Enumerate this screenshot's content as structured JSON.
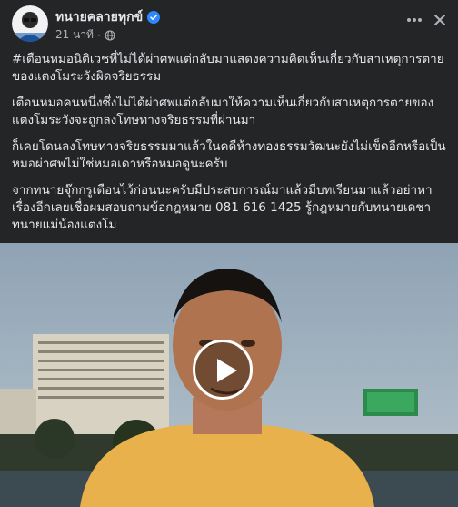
{
  "header": {
    "author": "ทนายคลายทุกข์",
    "timestamp": "21 นาที",
    "separator": "·",
    "verified": true,
    "privacy_icon": "globe-icon",
    "menu_icon": "more-icon",
    "close_icon": "close-icon"
  },
  "post": {
    "paragraphs": [
      "#เตือนหมอนิติเวชที่ไม่ได้ผ่าศพแต่กลับมาแสดงความคิดเห็นเกี่ยวกับสาเหตุการตายของแตงโมระวังผิดจริยธรรม",
      "เตือนหมอคนหนึ่งซึ่งไม่ได้ผ่าศพแต่กลับมาให้ความเห็นเกี่ยวกับสาเหตุการตายของแตงโมระวังจะถูกลงโทษทางจริยธรรมที่ผ่านมา",
      "ก็เคยโดนลงโทษทางจริยธรรมมาแล้วในคดีห้างทองธรรมวัฒนะยังไม่เข็ดอีกหรือเป็นหมอผ่าศพไม่ใช่หมอเดาหรือหมอดูนะครับ",
      "จากทนายจุ๊กกรูเตือนไว้ก่อนนะครับมีประสบการณ์มาแล้วมีบทเรียนมาแล้วอย่าหาเรื่องอีกเลยเชื่อผมสอบถามข้อกฎหมาย 081 616 1425 รู้กฎหมายกับทนายเดชาทนายแม่น้องแตงโม"
    ]
  },
  "video": {
    "play_icon": "play-icon"
  },
  "colors": {
    "background": "#242526",
    "text": "#e4e6eb",
    "secondary_text": "#b0b3b8",
    "verified": "#2d88ff"
  }
}
